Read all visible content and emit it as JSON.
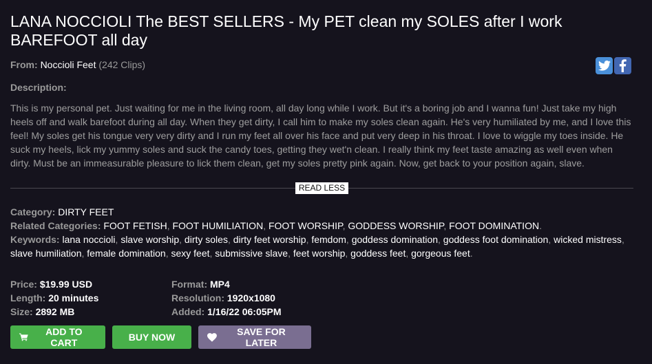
{
  "title": "LANA NOCCIOLI The BEST SELLERS - My PET clean my SOLES after I work BAREFOOT all day",
  "from": {
    "label": "From:",
    "studio": "Noccioli Feet",
    "count": "(242 Clips)"
  },
  "social": {
    "twitter_icon": "twitter-icon",
    "facebook_icon": "facebook-icon"
  },
  "description": {
    "label": "Description:",
    "text": "This is my personal pet. Just waiting for me in the living room, all day long while I work. But it's a boring job and I wanna fun! Just take my high heels off and walk barefoot during all day. When they get dirty, I call him to make my soles clean again. He's very humiliated by me, and I love this feel! My soles get his tongue very very dirty and I run my feet all over his face and put very deep in his throat. I love to wiggle my toes inside. He suck my heels, lick my yummy soles and suck the candy toes, getting they wet'n clean. I really think my feet taste amazing as well even when dirty. Must be an immeasurable pleasure to lick them clean, get my soles pretty pink again. Now, get back to your position again, slave.",
    "read_less": "READ LESS"
  },
  "category": {
    "label": "Category:",
    "value": "DIRTY FEET"
  },
  "related": {
    "label": "Related Categories:",
    "items": [
      "FOOT FETISH",
      "FOOT HUMILIATION",
      "FOOT WORSHIP",
      "GODDESS WORSHIP",
      "FOOT DOMINATION"
    ],
    "end": "."
  },
  "keywords": {
    "label": "Keywords:",
    "items": [
      "lana noccioli",
      "slave worship",
      "dirty soles",
      "dirty feet worship",
      "femdom",
      "goddess domination",
      "goddess foot domination",
      "wicked mistress",
      "slave humiliation",
      "female domination",
      "sexy feet",
      "submissive slave",
      "feet worship",
      "goddess feet",
      "gorgeous feet"
    ],
    "end": "."
  },
  "specs": {
    "price": {
      "label": "Price:",
      "value": "$19.99 USD"
    },
    "length": {
      "label": "Length:",
      "value": "20 minutes"
    },
    "size": {
      "label": "Size:",
      "value": "2892 MB"
    },
    "format": {
      "label": "Format:",
      "value": "MP4"
    },
    "resolution": {
      "label": "Resolution:",
      "value": "1920x1080"
    },
    "added": {
      "label": "Added:",
      "value": "1/16/22 06:05PM"
    }
  },
  "actions": {
    "add_to_cart": "ADD TO CART",
    "buy_now": "BUY NOW",
    "save_for_later": "SAVE FOR LATER"
  },
  "colors": {
    "background": "#15131d",
    "green": "#48b04a",
    "purple": "#7a6e91",
    "twitter": "#4a90d9",
    "facebook": "#4267b2"
  }
}
